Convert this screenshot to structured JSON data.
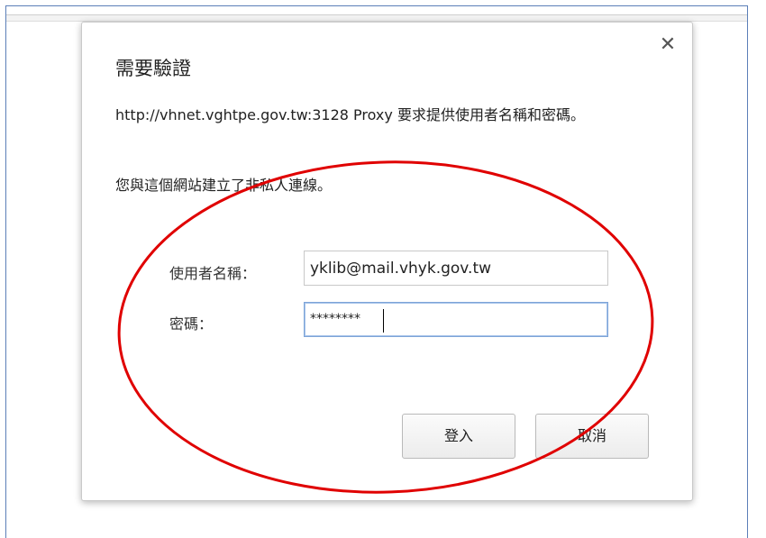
{
  "dialog": {
    "title": "需要驗證",
    "message": "http://vhnet.vghtpe.gov.tw:3128 Proxy 要求提供使用者名稱和密碼。",
    "warning": "您與這個網站建立了非私人連線。",
    "close_icon": "✕"
  },
  "form": {
    "username_label": "使用者名稱：",
    "username_value": "yklib@mail.vhyk.gov.tw",
    "password_label": "密碼：",
    "password_masked": "********"
  },
  "buttons": {
    "login_label": "登入",
    "cancel_label": "取消"
  },
  "colors": {
    "annotation": "#e00000",
    "focus_border": "#7da4d8"
  }
}
